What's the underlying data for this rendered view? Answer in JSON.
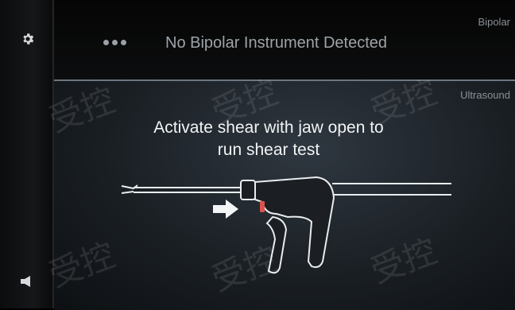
{
  "sidebar": {
    "settings_icon": "gear-icon",
    "volume_icon": "speaker-icon"
  },
  "header": {
    "bipolar_tab": "Bipolar",
    "menu_icon": "more-dots-icon",
    "status": "No Bipolar Instrument Detected"
  },
  "main": {
    "ultrasound_tab": "Ultrasound",
    "instruction_line1": "Activate shear with jaw open to",
    "instruction_line2": "run shear test",
    "illustration": "shear-device-illustration",
    "arrow_icon": "right-arrow-icon"
  },
  "watermark": "受控",
  "colors": {
    "background": "#000000",
    "panel": "#1c2126",
    "text": "#f2f4f5",
    "trigger_accent": "#d9534f"
  }
}
